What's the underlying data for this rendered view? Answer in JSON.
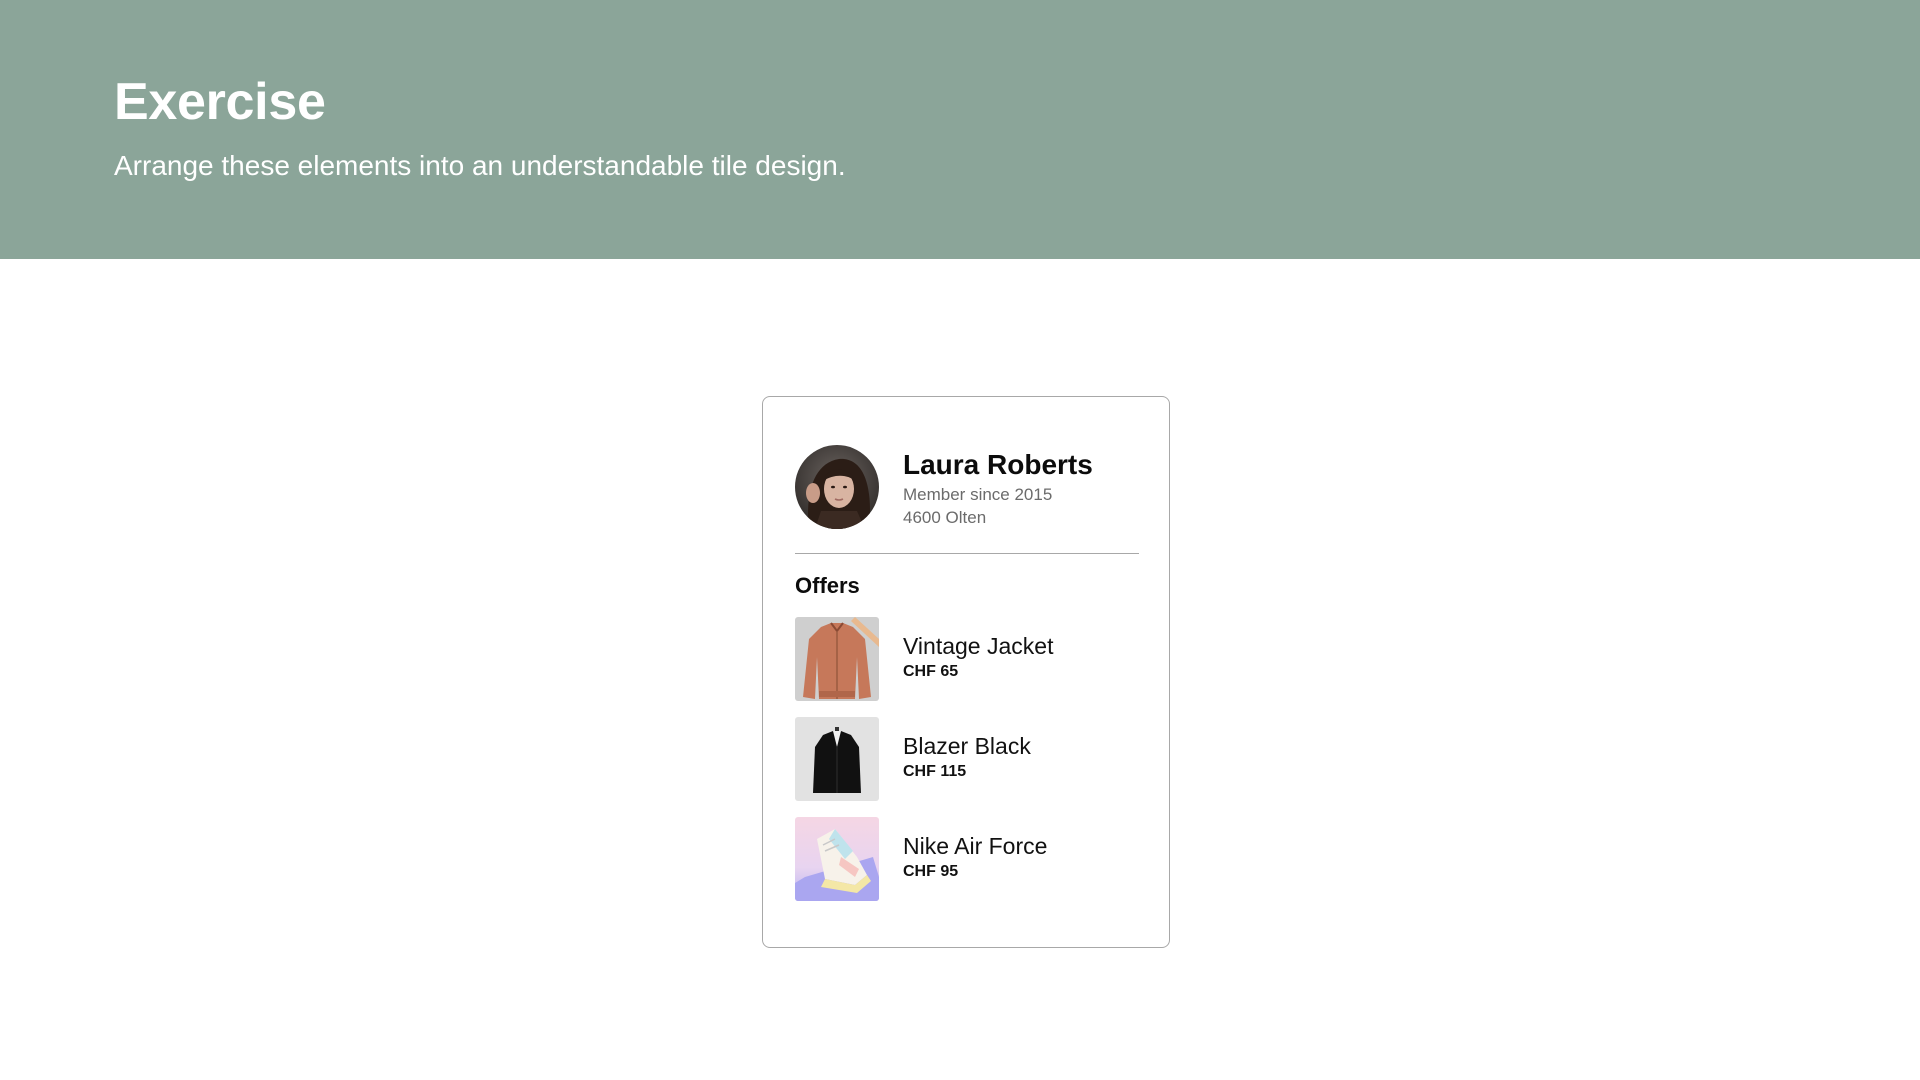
{
  "header": {
    "title": "Exercise",
    "subtitle": "Arrange these elements into an understandable tile design.",
    "background_color": "#8ba599"
  },
  "profile": {
    "name": "Laura Roberts",
    "member_since": "Member since 2015",
    "location": "4600 Olten"
  },
  "offers": {
    "heading": "Offers",
    "items": [
      {
        "name": "Vintage Jacket",
        "price": "CHF 65",
        "thumbnail_icon": "jacket-photo"
      },
      {
        "name": "Blazer Black",
        "price": "CHF 115",
        "thumbnail_icon": "blazer-photo"
      },
      {
        "name": "Nike Air Force",
        "price": "CHF 95",
        "thumbnail_icon": "sneaker-photo"
      }
    ]
  }
}
